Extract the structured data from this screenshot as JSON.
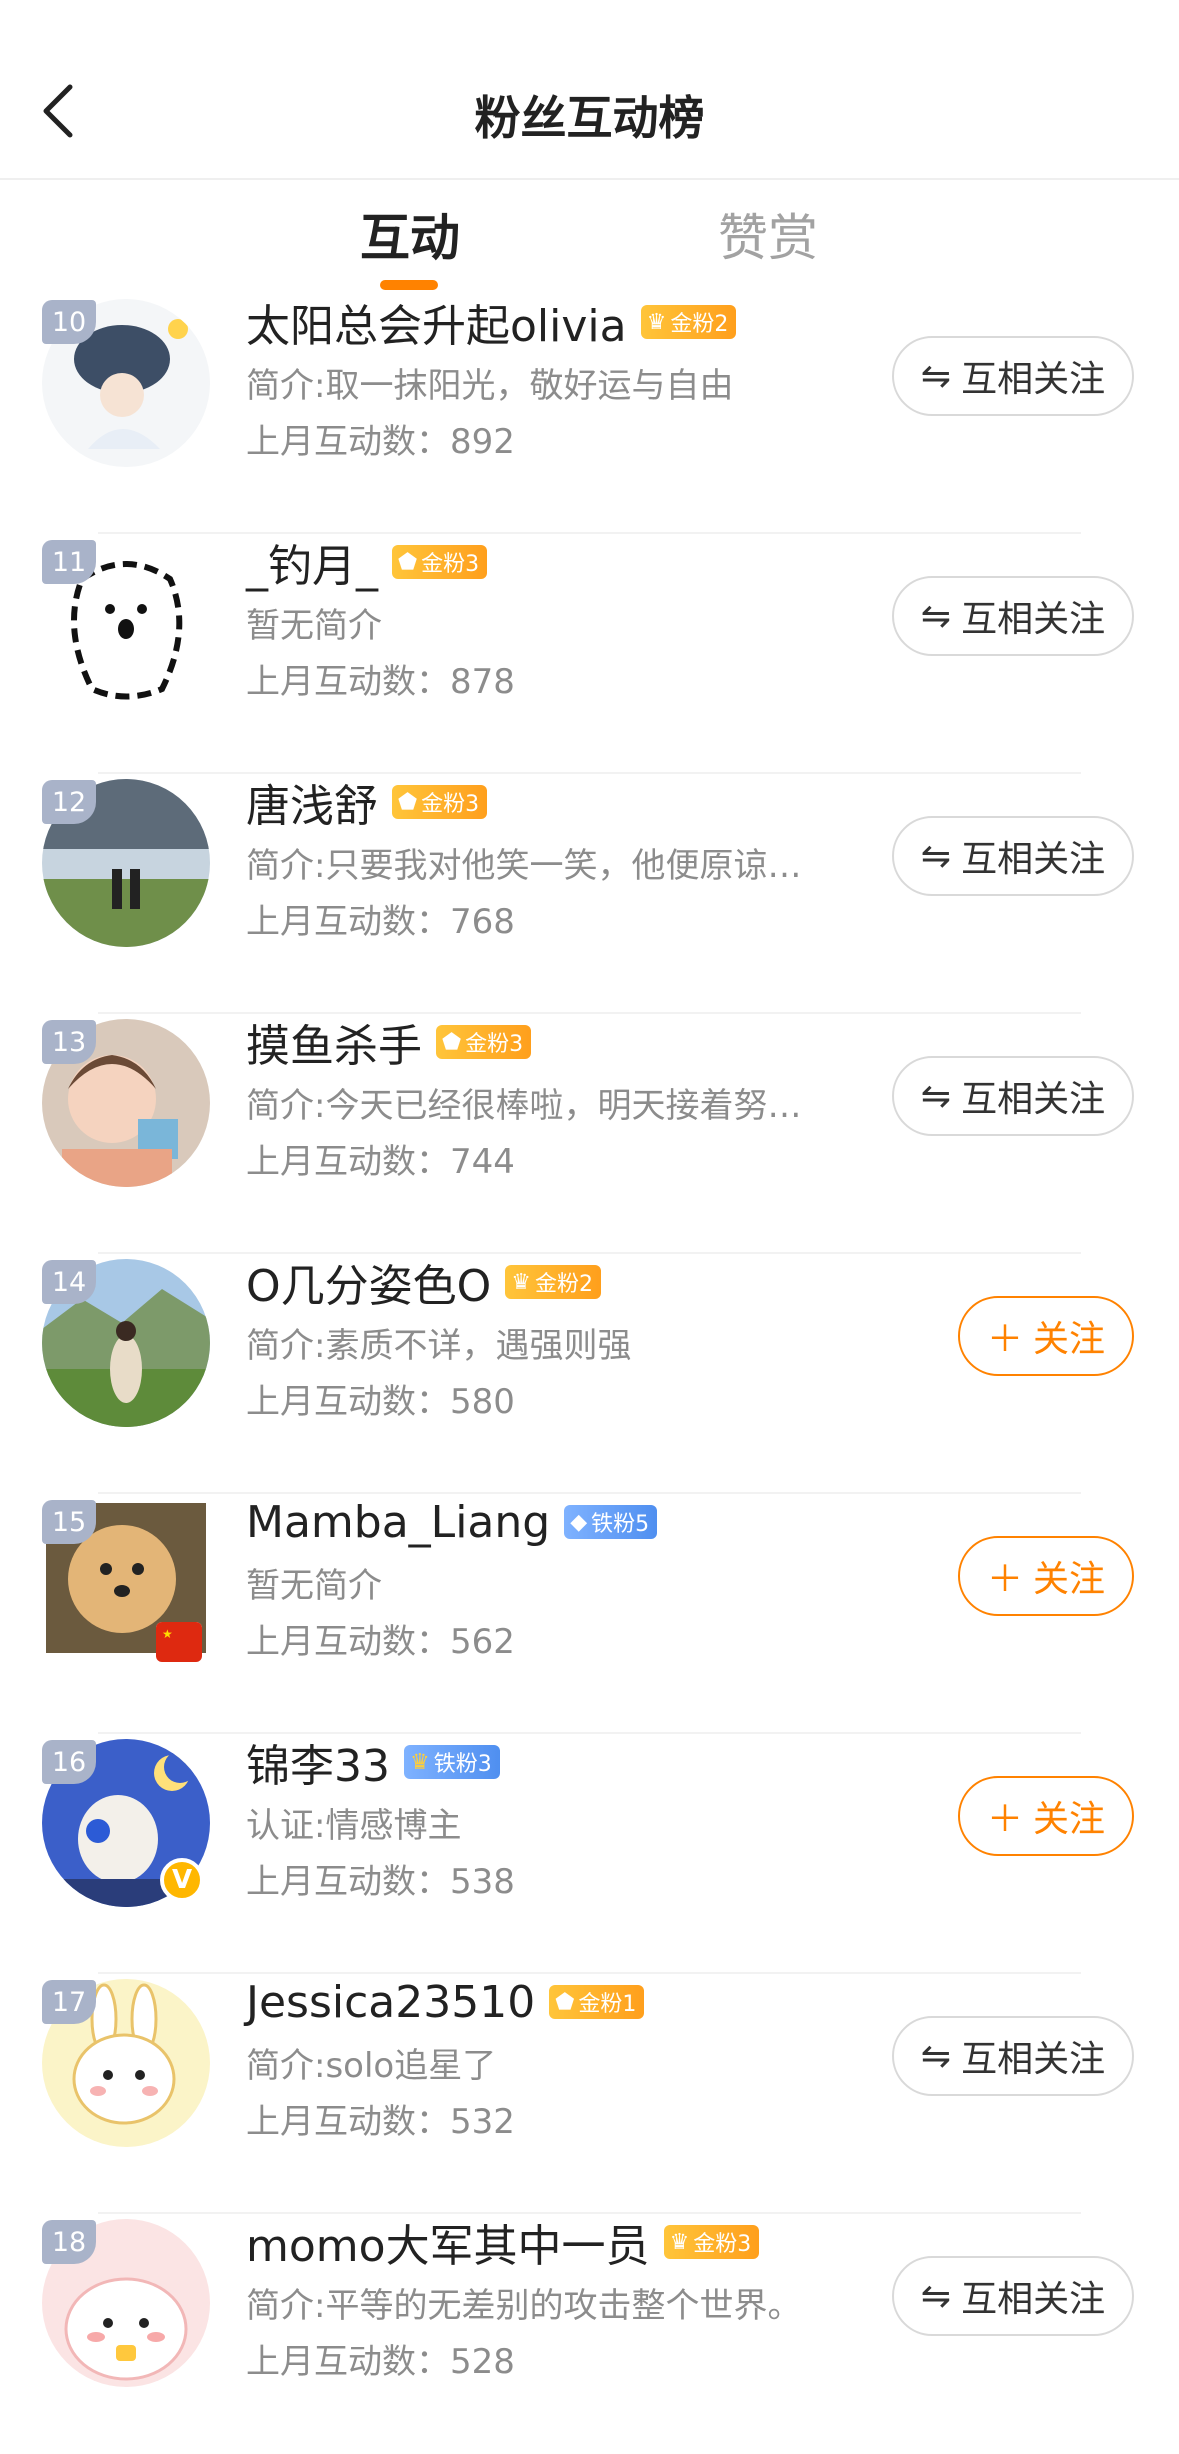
{
  "header": {
    "title": "粉丝互动榜",
    "back_icon": "chevron-left-icon"
  },
  "tabs": [
    {
      "label": "互动",
      "active": true
    },
    {
      "label": "赞赏",
      "active": false
    }
  ],
  "colors": {
    "accent": "#ff8200",
    "rank_badge": "#a9b3c9",
    "gold_badge": "#ffb13a",
    "iron_badge": "#5c9bf5",
    "secondary_text": "#8c8c8c"
  },
  "fans": [
    {
      "rank": "10",
      "name": "太阳总会升起olivia",
      "badge_label": "金粉2",
      "badge_type": "gold",
      "badge_icon": "crown-icon",
      "bio": "简介:取一抹阳光，敬好运与自由",
      "stat": "上月互动数：892",
      "action": "互相关注",
      "action_type": "mutual"
    },
    {
      "rank": "11",
      "name": "_钓月_",
      "badge_label": "金粉3",
      "badge_type": "gold",
      "badge_icon": "gem-icon",
      "bio": "暂无简介",
      "stat": "上月互动数：878",
      "action": "互相关注",
      "action_type": "mutual"
    },
    {
      "rank": "12",
      "name": "唐浅舒",
      "badge_label": "金粉3",
      "badge_type": "gold",
      "badge_icon": "gem-icon",
      "bio": "简介:只要我对他笑一笑，他便原谅…",
      "stat": "上月互动数：768",
      "action": "互相关注",
      "action_type": "mutual"
    },
    {
      "rank": "13",
      "name": "摸鱼杀手",
      "badge_label": "金粉3",
      "badge_type": "gold",
      "badge_icon": "gem-icon",
      "bio": "简介:今天已经很棒啦，明天接着努…",
      "stat": "上月互动数：744",
      "action": "互相关注",
      "action_type": "mutual"
    },
    {
      "rank": "14",
      "name": "O几分姿色O",
      "badge_label": "金粉2",
      "badge_type": "gold",
      "badge_icon": "crown-icon",
      "bio": "简介:素质不详，遇强则强",
      "stat": "上月互动数：580",
      "action": "关注",
      "action_type": "follow"
    },
    {
      "rank": "15",
      "name": "Mamba_Liang",
      "badge_label": "铁粉5",
      "badge_type": "iron",
      "badge_icon": "diamond-icon",
      "bio": "暂无简介",
      "stat": "上月互动数：562",
      "action": "关注",
      "action_type": "follow"
    },
    {
      "rank": "16",
      "name": "锦李33",
      "badge_label": "铁粉3",
      "badge_type": "iron",
      "badge_icon": "crown-icon",
      "bio": "认证:情感博主",
      "stat": "上月互动数：538",
      "action": "关注",
      "action_type": "follow"
    },
    {
      "rank": "17",
      "name": "Jessica23510",
      "badge_label": "金粉1",
      "badge_type": "gold",
      "badge_icon": "gem-icon",
      "bio": "简介:solo追星了",
      "stat": "上月互动数：532",
      "action": "互相关注",
      "action_type": "mutual"
    },
    {
      "rank": "18",
      "name": "momo大军其中一员",
      "badge_label": "金粉3",
      "badge_type": "gold",
      "badge_icon": "crown-icon",
      "bio": "简介:平等的无差别的攻击整个世界。",
      "stat": "上月互动数：528",
      "action": "互相关注",
      "action_type": "mutual"
    }
  ]
}
